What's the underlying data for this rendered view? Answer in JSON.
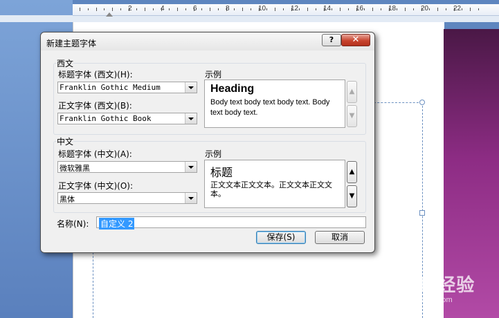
{
  "ruler": {
    "numbers": [
      "2",
      "4",
      "6",
      "8",
      "10",
      "12",
      "14",
      "16",
      "18",
      "20",
      "22"
    ]
  },
  "watermark": {
    "brand": "Baidu经验",
    "url": "jingyan.baidu.com"
  },
  "dialog": {
    "title": "新建主题字体",
    "help_label": "?",
    "close_label": "✕",
    "western": {
      "group_label": "西文",
      "heading_font_label": "标题字体 (西文)(H):",
      "heading_font_value": "Franklin Gothic Medium",
      "body_font_label": "正文字体 (西文)(B):",
      "body_font_value": "Franklin Gothic Book",
      "sample_label": "示例",
      "sample_heading": "Heading",
      "sample_body": "Body text body text body text. Body text body text."
    },
    "chinese": {
      "group_label": "中文",
      "heading_font_label": "标题字体 (中文)(A):",
      "heading_font_value": "微软雅黑",
      "body_font_label": "正文字体 (中文)(O):",
      "body_font_value": "黑体",
      "sample_label": "示例",
      "sample_heading": "标题",
      "sample_body": "正文文本正文文本。正文文本正文文本。"
    },
    "name_label": "名称(N):",
    "name_value": "自定义 2",
    "save_label": "保存(S)",
    "cancel_label": "取消"
  }
}
